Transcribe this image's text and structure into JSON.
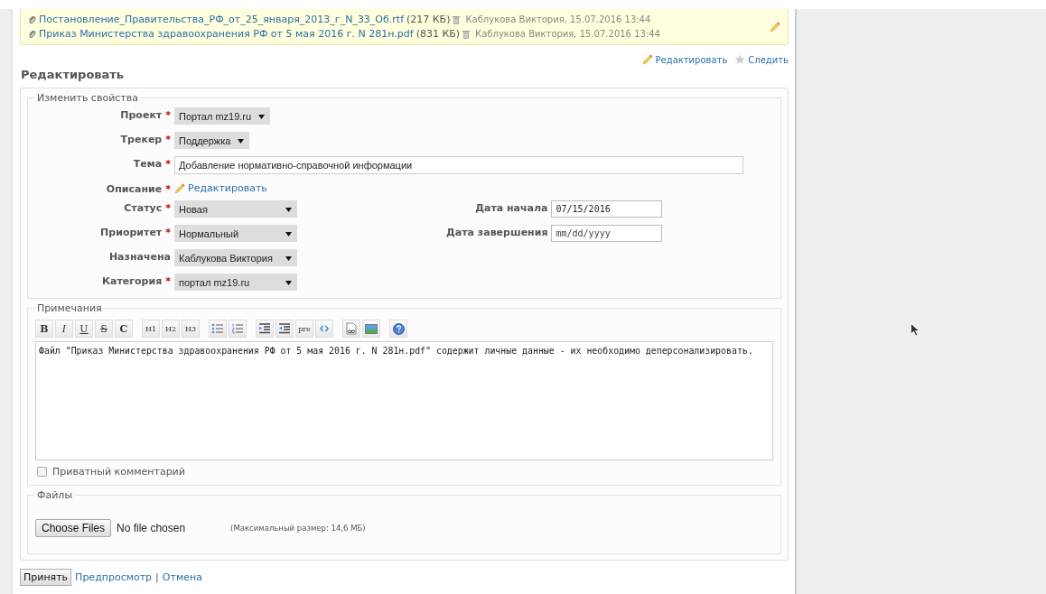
{
  "attachments": [
    {
      "name": "Постановление_Правительства_РФ_от_25_января_2013_г_N_33_Об.rtf",
      "size": "(217 КБ)",
      "meta": "Каблукова Виктория, 15.07.2016 13:44"
    },
    {
      "name": "Приказ Министерства здравоохранения РФ от 5 мая 2016 г. N 281н.pdf",
      "size": "(831 КБ)",
      "meta": "Каблукова Виктория, 15.07.2016 13:44"
    }
  ],
  "actions": [
    {
      "kind": "edit",
      "label": "Редактировать"
    },
    {
      "kind": "watch",
      "label": "Следить"
    }
  ],
  "heading": "Редактировать",
  "properties": {
    "legend": "Изменить свойства",
    "top_fields": [
      {
        "label": "Проект",
        "mark": "*",
        "kind": "dropdown",
        "value": "Портал mz19.ru"
      },
      {
        "label": "Трекер",
        "mark": "*",
        "kind": "dropdown",
        "value": "Поддержка"
      },
      {
        "label": "Тема",
        "mark": "*",
        "kind": "text",
        "value": "Добавление нормативно-справочной информации"
      },
      {
        "label": "Описание",
        "mark": "*",
        "kind": "link",
        "value": "Редактировать"
      }
    ],
    "left_fields": [
      {
        "label": "Статус",
        "mark": "*",
        "kind": "select",
        "value": "Новая"
      },
      {
        "label": "Приоритет",
        "mark": "*",
        "kind": "select",
        "value": "Нормальный"
      },
      {
        "label": "Назначена",
        "kind": "select",
        "value": "Каблукова Виктория"
      },
      {
        "label": "Категория",
        "mark": "*",
        "kind": "select",
        "value": "портал mz19.ru"
      }
    ],
    "right_fields": [
      {
        "label": "Дата начала",
        "kind": "date",
        "value": "07/15/2016"
      },
      {
        "label": "Дата завершения",
        "kind": "date",
        "placeholder": "mm/dd/yyyy"
      }
    ]
  },
  "notes": {
    "legend": "Примечания",
    "toolbar": [
      {
        "kind": "bold",
        "label": "B"
      },
      {
        "kind": "italic",
        "label": "I"
      },
      {
        "kind": "underline",
        "label": "U"
      },
      {
        "kind": "strike",
        "label": "S"
      },
      {
        "kind": "code",
        "label": "C"
      },
      {
        "kind": "separator"
      },
      {
        "kind": "heading",
        "label": "H1"
      },
      {
        "kind": "heading",
        "label": "H2"
      },
      {
        "kind": "heading",
        "label": "H3"
      },
      {
        "kind": "separator"
      },
      {
        "kind": "bullets"
      },
      {
        "kind": "numbers"
      },
      {
        "kind": "separator"
      },
      {
        "kind": "indent"
      },
      {
        "kind": "outdent"
      },
      {
        "kind": "pre",
        "label": "pre"
      },
      {
        "kind": "html"
      },
      {
        "kind": "separator"
      },
      {
        "kind": "link"
      },
      {
        "kind": "image"
      },
      {
        "kind": "separator"
      },
      {
        "kind": "help"
      }
    ],
    "value": "Файл \"Приказ Министерства здравоохранения РФ от 5 мая 2016 г. N 281н.pdf\" содержит личные данные - их необходимо деперсонализировать.",
    "private": {
      "label": "Приватный комментарий",
      "checked": false
    }
  },
  "files": {
    "legend": "Файлы",
    "button": "Choose Files",
    "status": "No file chosen",
    "hint": "(Максимальный размер: 14,6 МБ)"
  },
  "footer": {
    "submit": "Принять",
    "links": [
      "Предпросмотр",
      "Отмена"
    ],
    "separator": "|"
  }
}
